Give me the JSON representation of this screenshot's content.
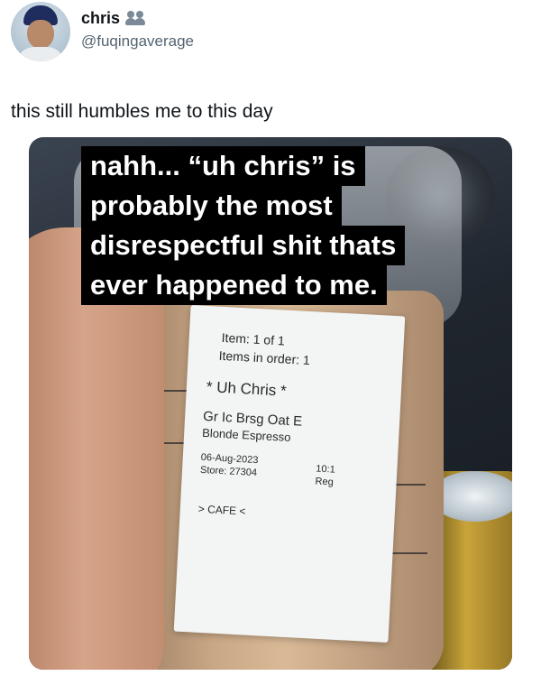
{
  "user": {
    "display_name": "chris",
    "handle": "@fuqingaverage",
    "badge_icon": "people-icon"
  },
  "tweet": {
    "text": "this still humbles me to this day"
  },
  "media": {
    "caption_lines": [
      "nahh... “uh chris” is",
      "probably the most",
      "disrespectful shit thats",
      "ever happened to me."
    ],
    "receipt": {
      "item": "Item: 1 of 1",
      "items_in_order": "Items in order: 1",
      "customer": "* Uh Chris *",
      "drink": "Gr Ic Brsg Oat E",
      "espresso": "Blonde Espresso",
      "date": "06-Aug-2023",
      "store": "Store: 27304",
      "time": "10:1",
      "register": "Reg",
      "station": "> CAFE <"
    }
  }
}
